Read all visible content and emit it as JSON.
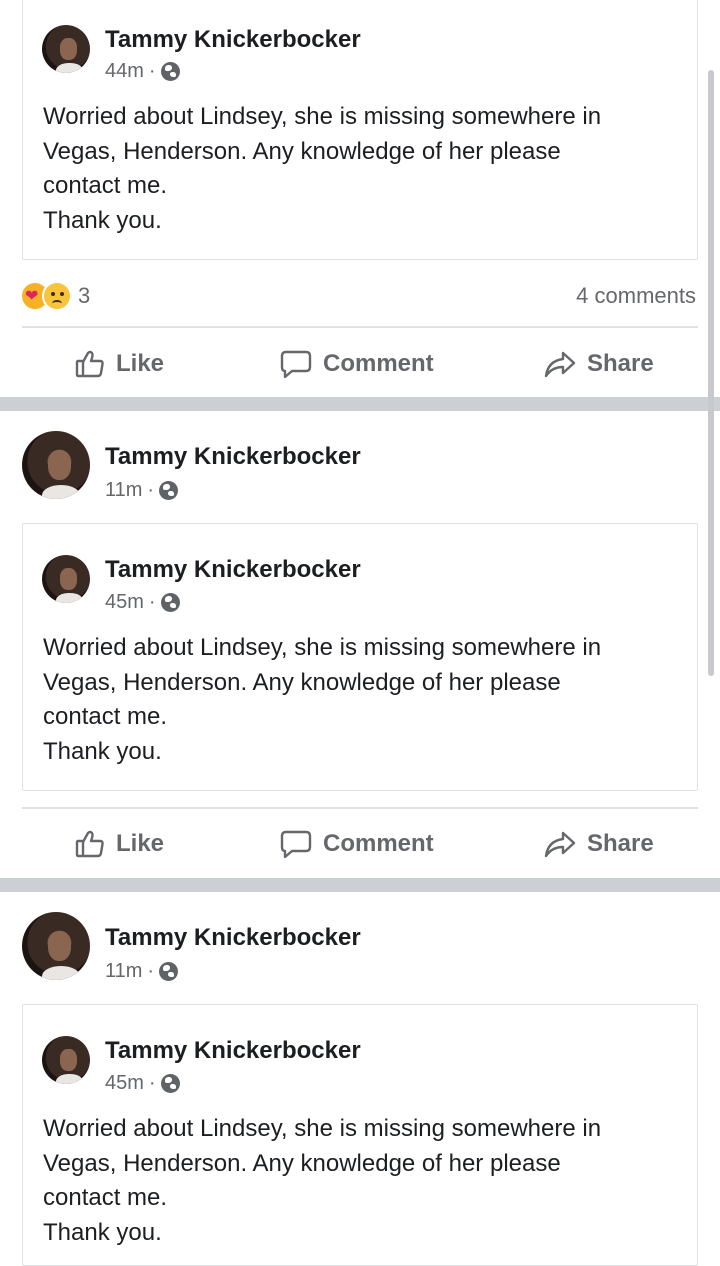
{
  "posts": [
    {
      "author": "Tammy Knickerbocker",
      "time": "44m",
      "separator": "·",
      "text_lines": [
        "Worried about Lindsey, she is missing somewhere in",
        "Vegas, Henderson.  Any knowledge of her please",
        "contact me.",
        "Thank you."
      ],
      "reactions": {
        "count": "3",
        "types": [
          "care-icon",
          "sad-icon"
        ]
      },
      "comments_count": "4 comments",
      "actions": {
        "like": "Like",
        "comment": "Comment",
        "share": "Share"
      }
    },
    {
      "author": "Tammy Knickerbocker",
      "time": "11m",
      "separator": "·",
      "shared": {
        "author": "Tammy Knickerbocker",
        "time": "45m",
        "separator": "·",
        "text_lines": [
          "Worried about Lindsey, she is missing somewhere in",
          "Vegas, Henderson.  Any knowledge of her please",
          "contact me.",
          "Thank you."
        ]
      },
      "actions": {
        "like": "Like",
        "comment": "Comment",
        "share": "Share"
      }
    },
    {
      "author": "Tammy Knickerbocker",
      "time": "11m",
      "separator": "·",
      "shared": {
        "author": "Tammy Knickerbocker",
        "time": "45m",
        "separator": "·",
        "text_lines": [
          "Worried about Lindsey, she is missing somewhere in",
          "Vegas, Henderson.  Any knowledge of her please",
          "contact me.",
          "Thank you."
        ]
      }
    }
  ],
  "colors": {
    "text": "#1c1e21",
    "secondary": "#65676b",
    "divider": "#ccd0d5",
    "border": "#dfe1e5"
  }
}
